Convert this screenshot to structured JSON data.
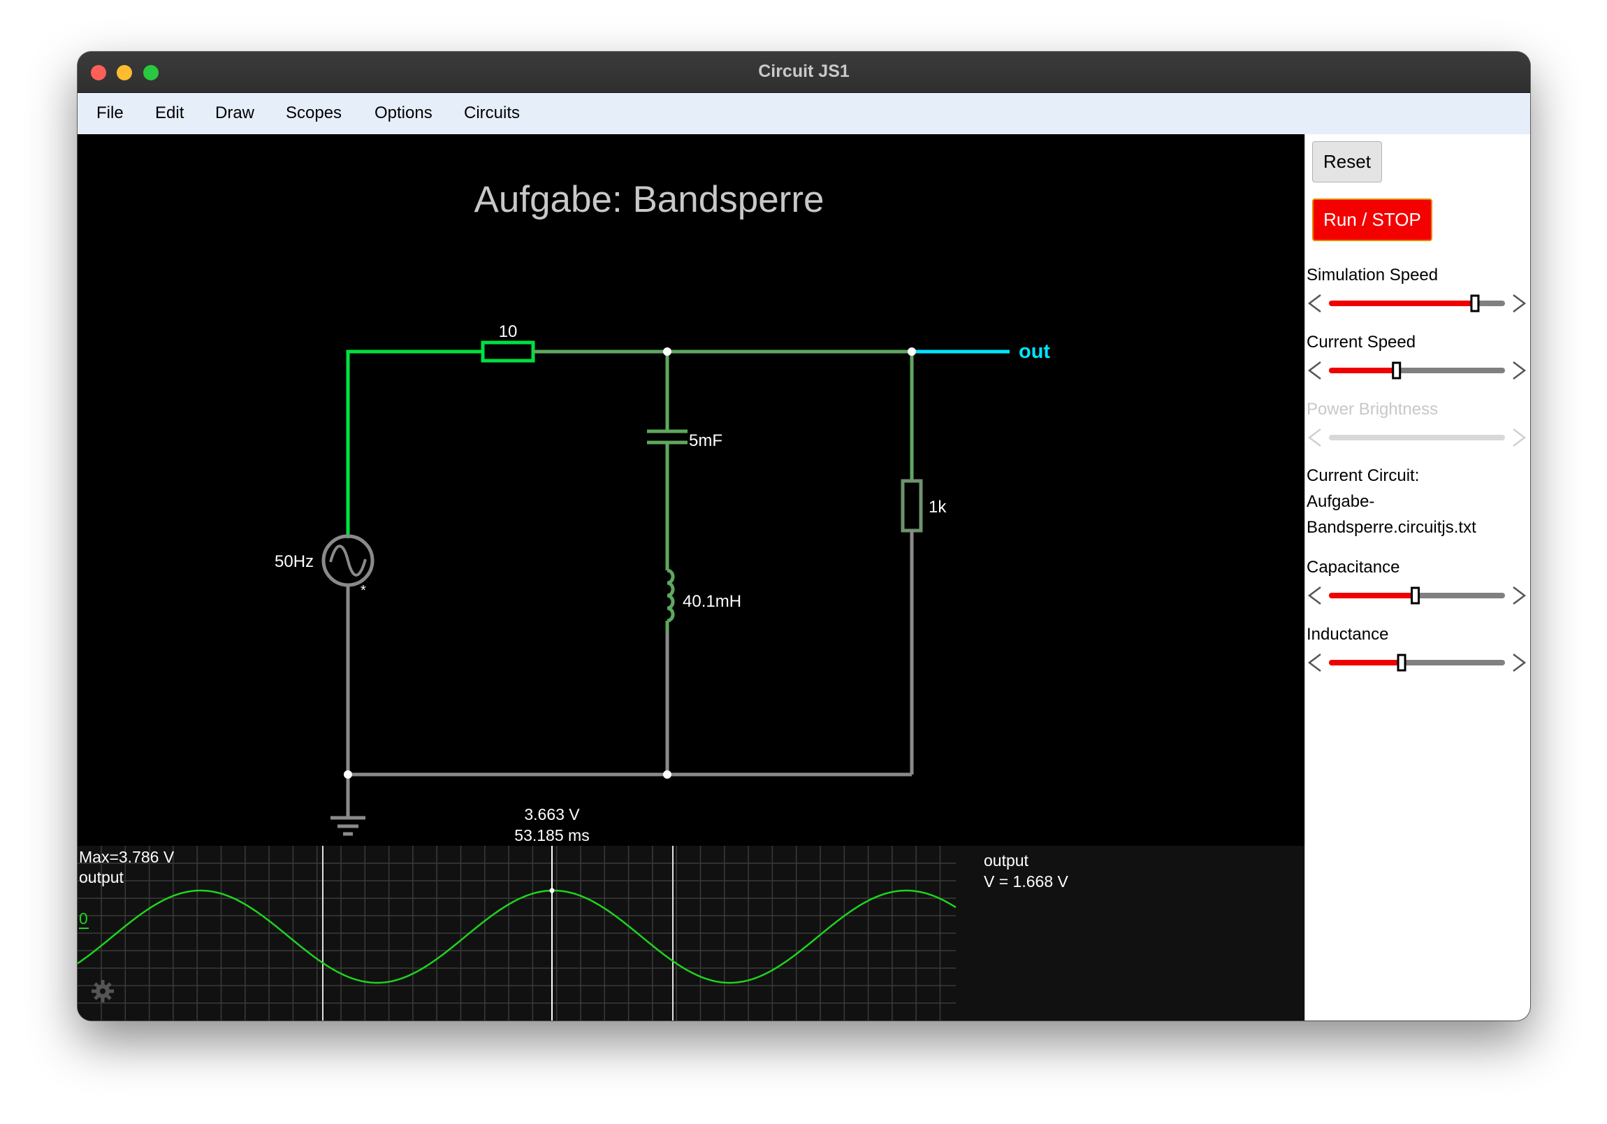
{
  "window": {
    "title": "Circuit JS1"
  },
  "menu": [
    "File",
    "Edit",
    "Draw",
    "Scopes",
    "Options",
    "Circuits"
  ],
  "circuit": {
    "title": "Aufgabe: Bandsperre",
    "resistor_top": "10",
    "capacitor": "5mF",
    "inductor": "40.1mH",
    "resistor_right": "1k",
    "source": "50Hz",
    "source_marker": "*",
    "output_label": "out"
  },
  "scope": {
    "cursor_voltage": "3.663 V",
    "cursor_time": "53.185 ms",
    "max_label": "Max=3.786 V",
    "trace_name": "output",
    "zero_label": "0",
    "info_name": "output",
    "info_value": "V = 1.668 V"
  },
  "side": {
    "reset_label": "Reset",
    "run_label": "Run / STOP",
    "sliders": [
      {
        "label": "Simulation Speed",
        "value": 0.84,
        "enabled": true
      },
      {
        "label": "Current Speed",
        "value": 0.38,
        "enabled": true
      },
      {
        "label": "Power Brightness",
        "value": 0.5,
        "enabled": false
      }
    ],
    "current_circuit_heading": "Current Circuit:",
    "current_circuit_lines": [
      "Aufgabe-",
      "Bandsperre.circuitjs.txt"
    ],
    "sliders2": [
      {
        "label": "Capacitance",
        "value": 0.49
      },
      {
        "label": "Inductance",
        "value": 0.41
      }
    ]
  },
  "colors": {
    "wire_bright": "#00e040",
    "wire_mid": "#5fa85f",
    "wire_gray": "#8a8a8a",
    "wire_cyan": "#00e5ff",
    "trace": "#1ed31e",
    "slider_red": "#f00000"
  }
}
